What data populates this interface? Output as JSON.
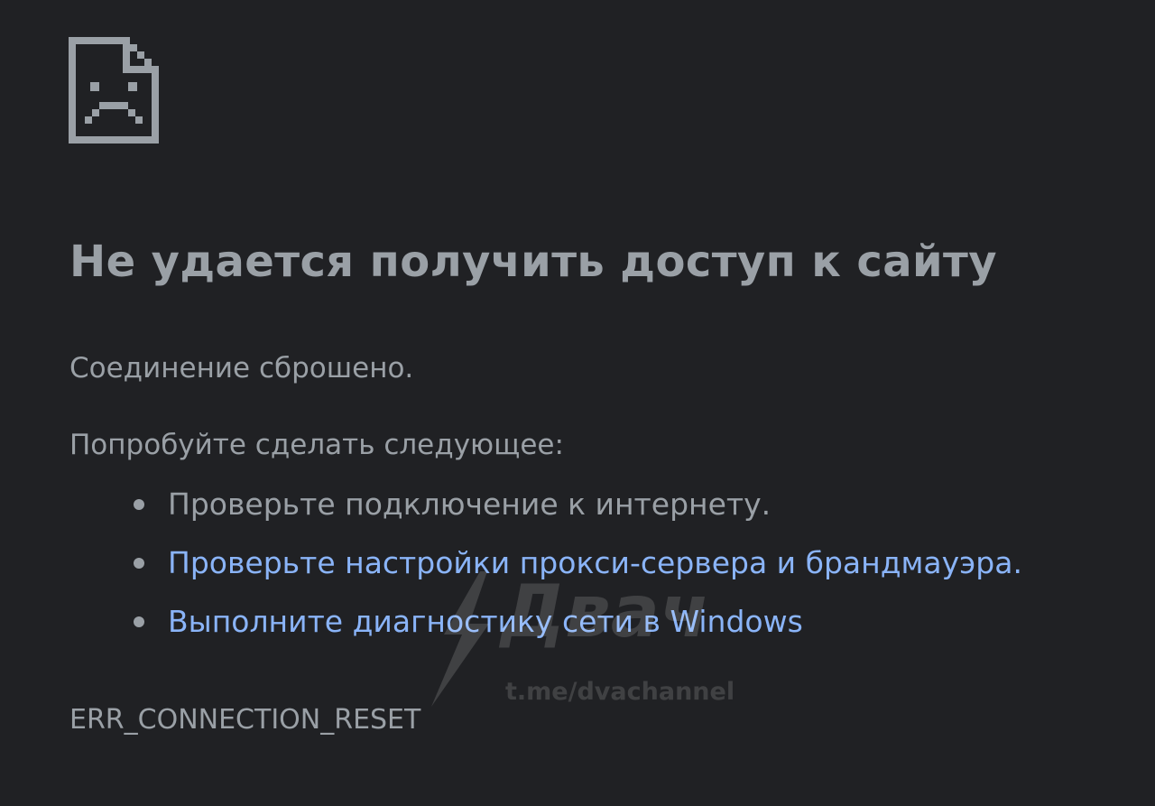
{
  "error_icon": "sad-page-icon",
  "title": "Не удается получить доступ к сайту",
  "summary": "Соединение сброшено.",
  "suggestions_heading": "Попробуйте сделать следующее:",
  "suggestions": [
    {
      "text": "Проверьте подключение к интернету.",
      "is_link": false
    },
    {
      "text": "Проверьте настройки прокси-сервера и брандмауэра.",
      "is_link": true
    },
    {
      "text": "Выполните диагностику сети в Windows",
      "is_link": true
    }
  ],
  "error_code": "ERR_CONNECTION_RESET",
  "watermark": {
    "brand": "Двач",
    "url": "t.me/dvachannel"
  },
  "colors": {
    "background": "#202124",
    "text": "#9aa0a6",
    "link": "#8ab4f8"
  }
}
